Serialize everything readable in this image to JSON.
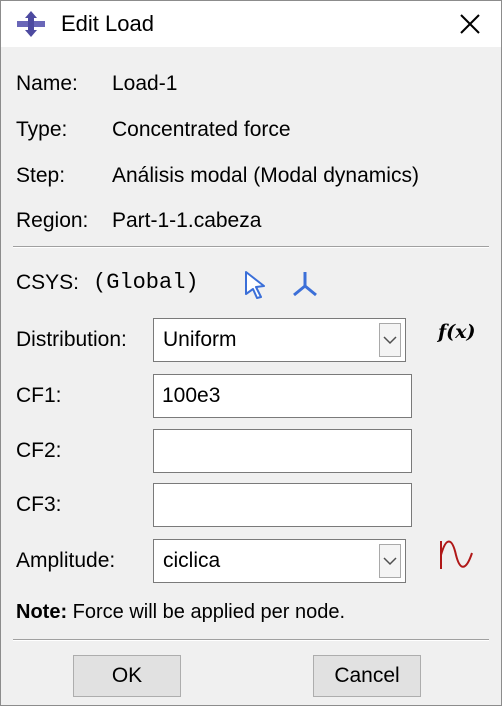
{
  "window": {
    "title": "Edit Load",
    "close_icon": "close-icon",
    "app_icon": "load-icon"
  },
  "info": {
    "name_label": "Name:",
    "name_value": "Load-1",
    "type_label": "Type:",
    "type_value": "Concentrated force",
    "step_label": "Step:",
    "step_value": "Análisis modal (Modal dynamics)",
    "region_label": "Region:",
    "region_value": "Part-1-1.cabeza"
  },
  "csys": {
    "label": "CSYS:",
    "value": "(Global)",
    "select_icon": "arrow-pointer-icon",
    "create_icon": "axes-icon"
  },
  "distribution": {
    "label": "Distribution:",
    "value": "Uniform",
    "fx_label": "f(x)"
  },
  "cf1": {
    "label": "CF1:",
    "value": "100e3"
  },
  "cf2": {
    "label": "CF2:",
    "value": ""
  },
  "cf3": {
    "label": "CF3:",
    "value": ""
  },
  "amplitude": {
    "label": "Amplitude:",
    "value": "ciclica",
    "create_icon": "amplitude-wave-icon"
  },
  "note": {
    "bold": "Note:",
    "text": "Force will be applied per node."
  },
  "buttons": {
    "ok": "OK",
    "cancel": "Cancel"
  },
  "colors": {
    "accent_blue": "#3b6fd8",
    "icon_purple": "#4d4aa0",
    "wave_red": "#b01818"
  }
}
